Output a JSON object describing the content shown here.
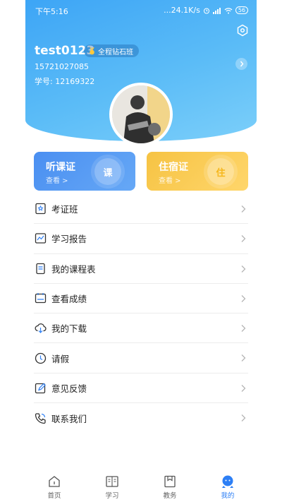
{
  "status_bar": {
    "time": "下午5:16",
    "network_speed": "...24.1K/s",
    "battery": "56"
  },
  "profile": {
    "username": "test0123",
    "vip_badge": "全程钻石班",
    "phone": "15721027085",
    "student_id": "学号: 12169322"
  },
  "cards": [
    {
      "title": "听课证",
      "sub": "查看 >",
      "glyph": "课"
    },
    {
      "title": "住宿证",
      "sub": "查看 >",
      "glyph": "住"
    }
  ],
  "menu": [
    {
      "label": "考证班",
      "icon": "certificate-icon"
    },
    {
      "label": "学习报告",
      "icon": "report-icon"
    },
    {
      "label": "我的课程表",
      "icon": "schedule-icon"
    },
    {
      "label": "查看成绩",
      "icon": "grades-icon"
    },
    {
      "label": "我的下载",
      "icon": "download-icon"
    },
    {
      "label": "请假",
      "icon": "clock-icon"
    },
    {
      "label": "意见反馈",
      "icon": "feedback-icon"
    },
    {
      "label": "联系我们",
      "icon": "phone-icon"
    }
  ],
  "bottom_nav": [
    {
      "label": "首页",
      "icon": "home-icon"
    },
    {
      "label": "学习",
      "icon": "book-icon"
    },
    {
      "label": "教务",
      "icon": "admin-icon"
    },
    {
      "label": "我的",
      "icon": "profile-icon",
      "active": true
    }
  ],
  "colors": {
    "primary": "#3da5f6",
    "card_blue": "#4a8ff1",
    "card_orange": "#f6c343",
    "active_nav": "#2d7ff5"
  }
}
